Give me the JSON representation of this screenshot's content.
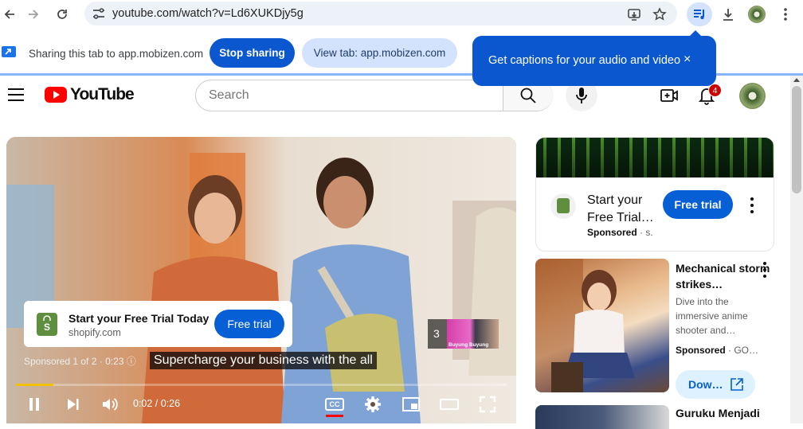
{
  "browser": {
    "url": "youtube.com/watch?v=Ld6XUKDjy5g"
  },
  "sharing_bar": {
    "message": "Sharing this tab to app.mobizen.com",
    "stop_label": "Stop sharing",
    "view_label": "View tab: app.mobizen.com"
  },
  "caption_bubble": {
    "text": "Get captions for your audio and video",
    "close": "×"
  },
  "header": {
    "logo_text": "YouTube",
    "search_placeholder": "Search",
    "notification_count": "4"
  },
  "player": {
    "ad": {
      "title": "Start your Free Trial Today",
      "domain": "shopify.com",
      "cta": "Free trial",
      "sponsored": "Sponsored 1 of 2 · 0:23"
    },
    "subtitle": "Supercharge your business with the all",
    "up_next_count": "3",
    "up_next_thumb_text": "Buyung Buyung",
    "time": "0:02 / 0:26",
    "progress": 0.077,
    "cc_label": "CC"
  },
  "sidebar": {
    "promo": {
      "title": "Start your Free Trial…",
      "sponsored": "Sponsored",
      "sponsored_suffix": "· s.",
      "cta": "Free trial"
    },
    "rec1": {
      "title": "Mechanical storm strikes…",
      "description": "Dive into the immersive anime shooter and…",
      "sponsored": "Sponsored",
      "sponsored_suffix": "· GO…",
      "cta": "Dow…"
    },
    "rec2": {
      "title": "Guruku Menjadi"
    }
  },
  "colors": {
    "accent": "#0b57d0",
    "yt_red": "#ff0000",
    "button_blue": "#065fd4",
    "progress": "#f2c200"
  }
}
